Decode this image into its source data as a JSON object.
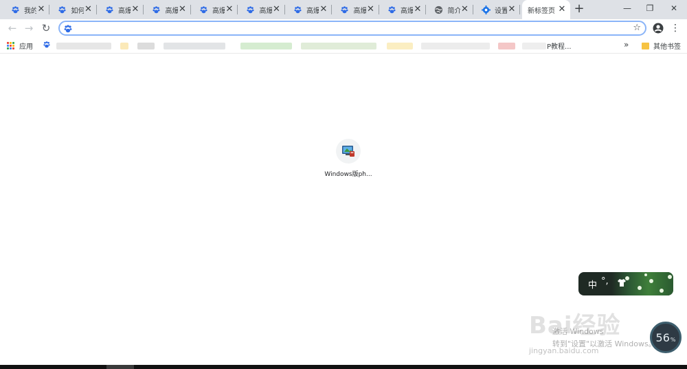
{
  "tabs": [
    {
      "title": "我的",
      "icon": "baidu-paw-icon"
    },
    {
      "title": "如何",
      "icon": "baidu-paw-icon"
    },
    {
      "title": "高爆",
      "icon": "baidu-paw-icon"
    },
    {
      "title": "高爆",
      "icon": "baidu-paw-icon"
    },
    {
      "title": "高爆",
      "icon": "baidu-paw-icon"
    },
    {
      "title": "高爆",
      "icon": "baidu-paw-icon"
    },
    {
      "title": "高爆",
      "icon": "baidu-paw-icon"
    },
    {
      "title": "高爆",
      "icon": "baidu-paw-icon"
    },
    {
      "title": "高爆",
      "icon": "baidu-paw-icon"
    },
    {
      "title": "简介",
      "icon": "globe-icon"
    },
    {
      "title": "设置",
      "icon": "gear-icon"
    }
  ],
  "active_tab": {
    "title": "新标签页"
  },
  "new_tab_symbol": "+",
  "window_controls": {
    "minimize": "—",
    "restore": "❐",
    "close": "✕"
  },
  "toolbar": {
    "back": "←",
    "forward": "→",
    "reload": "↻",
    "omnibox_value": "",
    "star": "☆",
    "menu": "⋮"
  },
  "bookmarks": {
    "apps_label": "应用",
    "visible_item_fragment": "P教程...",
    "more": "»",
    "other_label": "其他书签"
  },
  "shortcut_tile": {
    "label": "Windows版ph..."
  },
  "ime": {
    "mode": "中",
    "punct": "°,"
  },
  "watermark": {
    "brand": "Bai经验",
    "line1": "激活 Windows",
    "line2": "转到\"设置\"以激活 Windows。",
    "url": "jingyan.baidu.com"
  },
  "progress": {
    "value": "56",
    "unit": "%"
  },
  "colors": {
    "tabstrip": "#dee1e6",
    "omnibox_focus": "#8ab4f8",
    "baidu_blue": "#2e6be6"
  }
}
